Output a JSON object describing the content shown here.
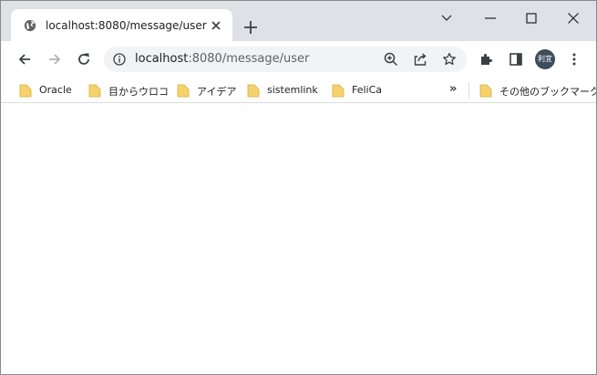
{
  "tab": {
    "title": "localhost:8080/message/user",
    "favicon": "globe-icon"
  },
  "window_controls": {
    "search": "chevron-down-icon",
    "minimize": "minimize-icon",
    "maximize": "maximize-icon",
    "close": "close-icon"
  },
  "toolbar": {
    "back": "back-arrow-icon",
    "forward": "forward-arrow-icon",
    "reload": "reload-icon",
    "extensions": "puzzle-icon",
    "side_panel": "side-panel-icon",
    "menu": "kebab-menu-icon"
  },
  "omnibox": {
    "host": "localhost",
    "path": ":8080/message/user",
    "info": "info-icon",
    "zoom": "zoom-icon",
    "share": "share-icon",
    "star": "star-icon"
  },
  "profile": {
    "avatar_text": "利宜"
  },
  "bookmarks": {
    "items": [
      {
        "label": "Oracle"
      },
      {
        "label": "目からウロコ"
      },
      {
        "label": "アイデア"
      },
      {
        "label": "sistemlink"
      },
      {
        "label": "FeliCa"
      }
    ],
    "more": "»",
    "other_label": "その他のブックマーク"
  },
  "colors": {
    "tabstrip": "#dee1e6",
    "omnibox": "#f1f3f4",
    "folder": "#f5d26b",
    "avatar": "#3c4d5c"
  }
}
